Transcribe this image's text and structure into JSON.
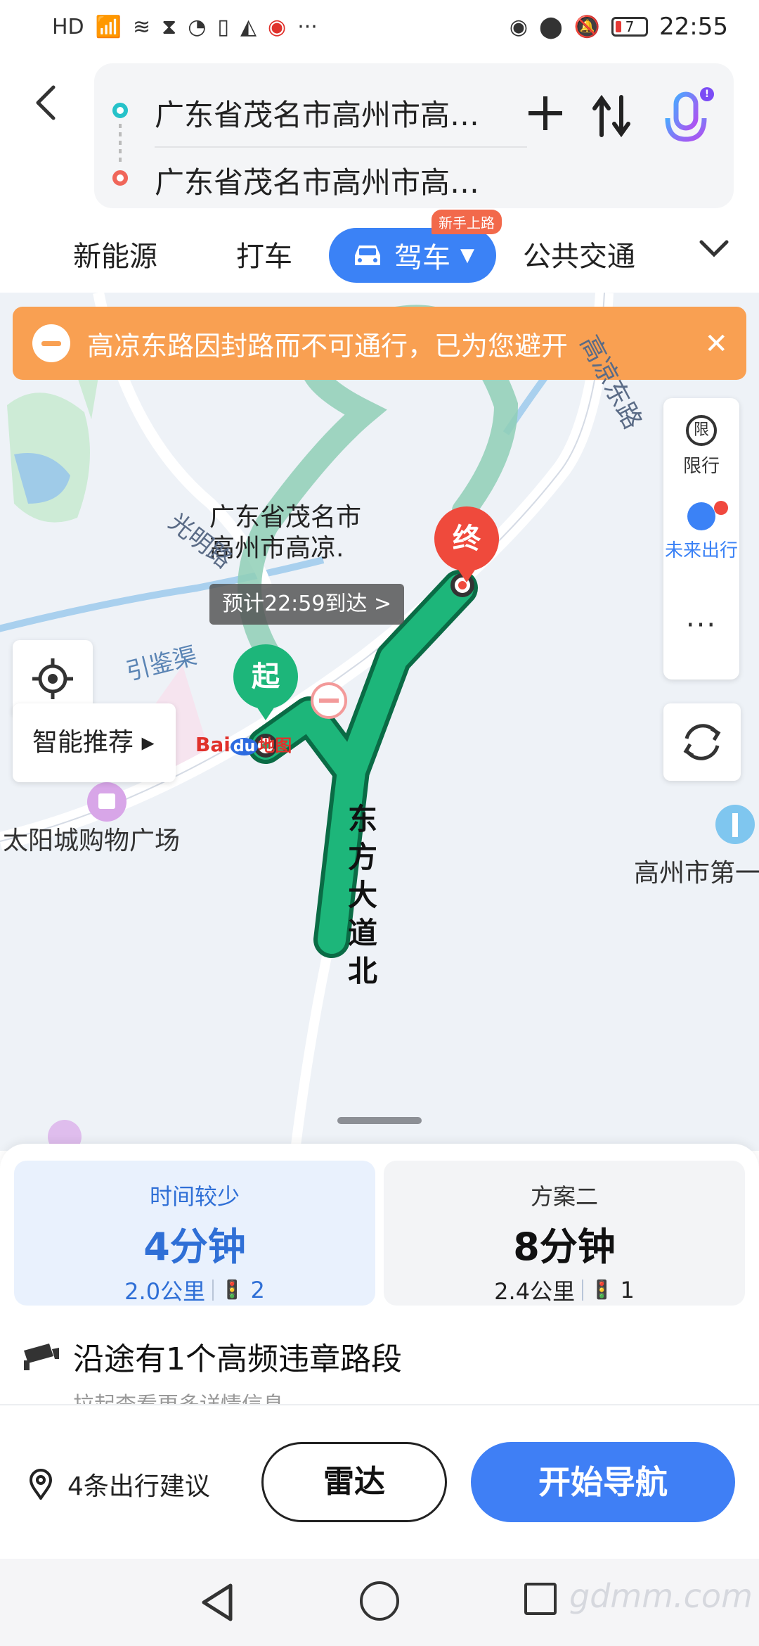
{
  "status_bar": {
    "left_icons": [
      "HD",
      "4G",
      "signal",
      "wifi",
      "hourglass",
      "wechat",
      "phone",
      "qq",
      "weibo",
      "···"
    ],
    "battery": "7",
    "time": "22:55"
  },
  "route": {
    "start": "广东省茂名市高州市高…",
    "end": "广东省茂名市高州市高…"
  },
  "tabs": {
    "new_energy": "新能源",
    "taxi": "打车",
    "drive": "驾车",
    "drive_badge": "新手上路",
    "transit": "公共交通"
  },
  "map": {
    "alert": "高凉东路因封路而不可通行，已为您避开",
    "side_panel": {
      "limit_icon": "限",
      "limit_label": "限行",
      "future_label": "未来出行",
      "more": "···"
    },
    "dest_name_line1": "广东省茂名市",
    "dest_name_line2": "高州市高凉.",
    "eta": "预计22:59到达 >",
    "pin_end": "终",
    "pin_start": "起",
    "labels": {
      "guangming": "光明路",
      "yinjianqu": "引鉴渠",
      "gaoliang": "高凉东路",
      "mall": "太阳城购物广场",
      "hospital": "高州市第一",
      "dongfang": "东方大道北"
    },
    "smart_recommend": "智能推荐 ▸",
    "logo_bai": "Bai",
    "logo_du": "du",
    "logo_map": "地图"
  },
  "options": [
    {
      "tag": "时间较少",
      "time": "4分钟",
      "distance": "2.0公里",
      "lights": "2"
    },
    {
      "tag": "方案二",
      "time": "8分钟",
      "distance": "2.4公里",
      "lights": "1"
    }
  ],
  "violation": {
    "title": "沿途有1个高频违章路段",
    "sub": "拉起查看更多详情信息"
  },
  "actions": {
    "suggest": "4条出行建议",
    "radar": "雷达",
    "navigate": "开始导航"
  },
  "watermark": "gdmm.com",
  "colors": {
    "accent": "#3f7ff5",
    "alert": "#f9a052",
    "route": "#1db67a",
    "end_pin": "#ef4a3c"
  }
}
